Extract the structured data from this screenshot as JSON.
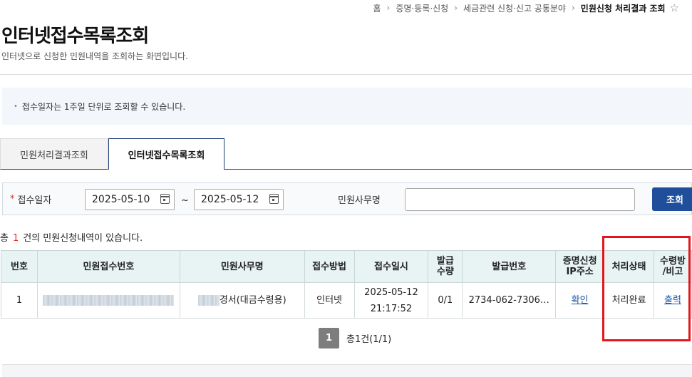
{
  "breadcrumb": {
    "home": "홈",
    "level1": "증명·등록·신청",
    "level2": "세금관련 신청·신고 공통분야",
    "current": "민원신청 처리결과 조회",
    "sep": "›"
  },
  "page": {
    "title": "인터넷접수목록조회",
    "description": "인터넷으로 신청한 민원내역을 조회하는 화면입니다."
  },
  "notice": {
    "text": "접수일자는 1주일 단위로 조회할 수 있습니다."
  },
  "tabs": [
    {
      "label": "민원처리결과조회",
      "active": false
    },
    {
      "label": "인터넷접수목록조회",
      "active": true
    }
  ],
  "search": {
    "date_label": "접수일자",
    "required_mark": "*",
    "start_date": "2025-05-10",
    "end_date": "2025-05-12",
    "tilde": "~",
    "office_label": "민원사무명",
    "office_value": "",
    "search_button": "조회"
  },
  "result": {
    "prefix": "총",
    "count": "1",
    "suffix": "건의 민원신청내역이 있습니다."
  },
  "table": {
    "headers": {
      "no": "번호",
      "receipt_no": "민원접수번호",
      "office_name": "민원사무명",
      "method": "접수방법",
      "received_at": "접수일시",
      "issue_qty_1": "발급",
      "issue_qty_2": "수량",
      "issue_no": "발급번호",
      "ip_1": "증명신청",
      "ip_2": "IP주소",
      "status": "처리상태",
      "receive_1": "수령방",
      "receive_2": "/비고"
    },
    "rows": [
      {
        "no": "1",
        "office_name_visible": "경서(대금수령용)",
        "method": "인터넷",
        "date": "2025-05-12",
        "time": "21:17:52",
        "qty": "0/1",
        "issue_no": "2734-062-7306…",
        "ip": "확인",
        "status": "처리완료",
        "receive": "출력"
      }
    ]
  },
  "pagination": {
    "current": "1",
    "info": "총1건(1/1)"
  },
  "colors": {
    "primary": "#1f4e9b",
    "header_bg": "#e8f3f3",
    "highlight_box": "#e3161d",
    "count_red": "#d9302c"
  }
}
